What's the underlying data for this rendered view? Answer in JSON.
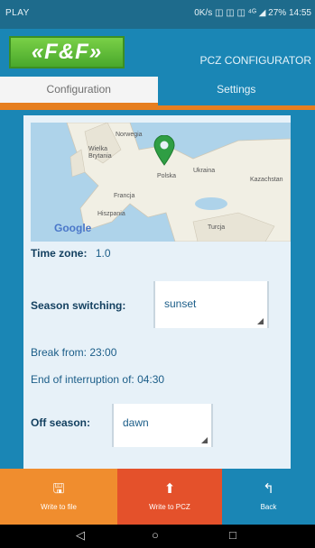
{
  "status_bar": {
    "left": "PLAY",
    "right": "0K/s ◫ ◫ ◫ ⁴ᴳ ◢ 27% 14:55"
  },
  "header": {
    "logo_text": "«F&F»",
    "title": "PCZ CONFIGURATOR"
  },
  "tabs": [
    {
      "label": "Configuration",
      "active": true
    },
    {
      "label": "Settings",
      "active": false
    }
  ],
  "map": {
    "labels": [
      "Norwegia",
      "Wielka Brytania",
      "Polska",
      "Ukraina",
      "Kazachstan",
      "Francja",
      "Hiszpania",
      "Turcja"
    ],
    "attribution": "Google"
  },
  "form": {
    "time_zone_label": "Time zone:",
    "time_zone_value": "1.0",
    "season_label": "Season switching:",
    "season_value": "sunset",
    "break_from": "Break from: 23:00",
    "end_interruption": "End of interruption of: 04:30",
    "off_season_label": "Off season:",
    "off_season_value": "dawn"
  },
  "bottom_buttons": [
    {
      "label": "Write to file",
      "icon": "save-icon",
      "color": "#f08d2e"
    },
    {
      "label": "Write to PCZ",
      "icon": "upload-icon",
      "color": "#e4512b"
    },
    {
      "label": "Back",
      "icon": "back-arrow-icon",
      "color": "#1a86b5"
    }
  ],
  "colors": {
    "primary": "#1a86b5",
    "accent": "#e67e1f",
    "panel": "#e7f1f8"
  }
}
